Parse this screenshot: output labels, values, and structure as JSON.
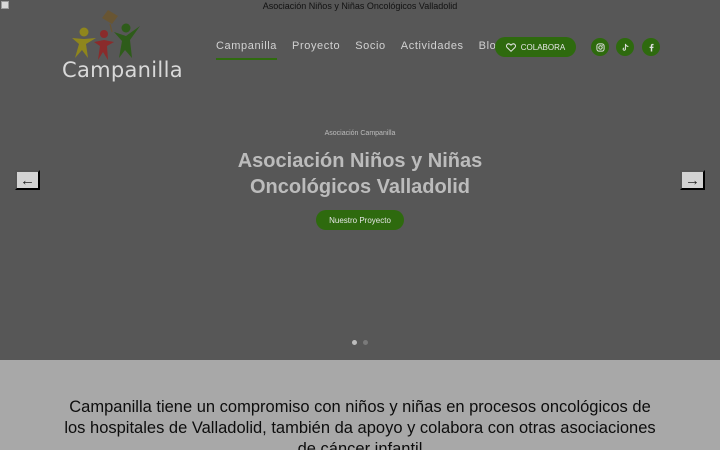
{
  "page": {
    "image_alt": "Asociación Niños y Niñas Oncológicos Valladolid"
  },
  "logo": {
    "text": "Campanilla"
  },
  "nav": {
    "items": [
      {
        "label": "Campanilla",
        "active": true
      },
      {
        "label": "Proyecto"
      },
      {
        "label": "Socio"
      },
      {
        "label": "Actividades"
      },
      {
        "label": "Blog"
      }
    ],
    "donate_label": "COLABORA"
  },
  "social": {
    "icons": [
      "instagram-icon",
      "tiktok-icon",
      "facebook-icon"
    ]
  },
  "hero": {
    "eyebrow": "Asociación Campanilla",
    "title_line1": "Asociación Niños y Niñas",
    "title_line2": "Oncológicos Valladolid",
    "cta_label": "Nuestro Proyecto",
    "prev_icon": "←",
    "next_icon": "→",
    "slides": 2,
    "active_slide": 1
  },
  "mission": {
    "line1": "Campanilla tiene un compromiso con niños y niñas en procesos oncológicos de",
    "line2": "los hospitales de Valladolid, también da apoyo y colabora con otras asociaciones",
    "line3": "de cáncer infantil"
  },
  "colors": {
    "brand_green": "#2e6a0e",
    "overlay": "#575757"
  }
}
